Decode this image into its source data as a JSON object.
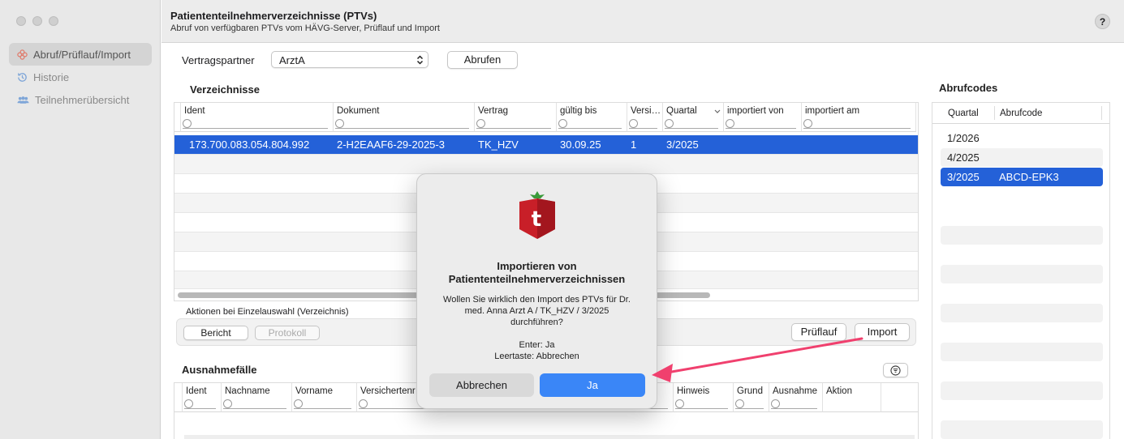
{
  "sidebar": {
    "items": [
      {
        "label": "Abruf/Prüflauf/Import"
      },
      {
        "label": "Historie"
      },
      {
        "label": "Teilnehmerübersicht"
      }
    ]
  },
  "header": {
    "title": "Patiententeilnehmerverzeichnisse (PTVs)",
    "subtitle": "Abruf von verfügbaren PTVs vom HÄVG-Server, Prüflauf und Import",
    "help": "?"
  },
  "toolbar": {
    "partner_label": "Vertragspartner",
    "partner_value": "ArztA",
    "fetch_label": "Abrufen"
  },
  "verzeichnisse": {
    "title": "Verzeichnisse",
    "columns": [
      "Ident",
      "Dokument",
      "Vertrag",
      "gültig bis",
      "Versi…",
      "Quartal",
      "importiert von",
      "importiert am"
    ],
    "selected_row": {
      "ident": "173.700.083.054.804.992",
      "dokument": "2-H2EAAF6-29-2025-3",
      "vertrag": "TK_HZV",
      "gueltig": "30.09.25",
      "version": "1",
      "quartal": "3/2025"
    }
  },
  "actions": {
    "title": "Aktionen bei Einzelauswahl (Verzeichnis)",
    "report": "Bericht",
    "protocol": "Protokoll",
    "check": "Prüflauf",
    "import": "Import"
  },
  "ausnahme": {
    "title": "Ausnahmefälle",
    "columns": [
      "Ident",
      "Nachname",
      "Vorname",
      "Versichertenr",
      "Hinweis",
      "Grund",
      "Ausnahme",
      "Aktion"
    ]
  },
  "abrufcodes": {
    "title": "Abrufcodes",
    "col_quartal": "Quartal",
    "col_code": "Abrufcode",
    "rows": [
      {
        "quartal": "1/2026",
        "code": ""
      },
      {
        "quartal": "4/2025",
        "code": ""
      },
      {
        "quartal": "3/2025",
        "code": "ABCD-EPK3"
      }
    ]
  },
  "dialog": {
    "logo_letter": "t",
    "title_line1": "Importieren von",
    "title_line2": "Patiententeilnehmerverzeichnissen",
    "msg_line1": "Wollen Sie wirklich den Import des PTVs für Dr.",
    "msg_line2": "med. Anna Arzt A / TK_HZV / 3/2025",
    "msg_line3": "durchführen?",
    "hint1": "Enter: Ja",
    "hint2": "Leertaste: Abbrechen",
    "cancel": "Abbrechen",
    "confirm": "Ja"
  },
  "colors": {
    "accent": "#2461d8",
    "button_blue": "#3a86f7",
    "arrow": "#f0406e",
    "logo_red": "#d8232a"
  }
}
